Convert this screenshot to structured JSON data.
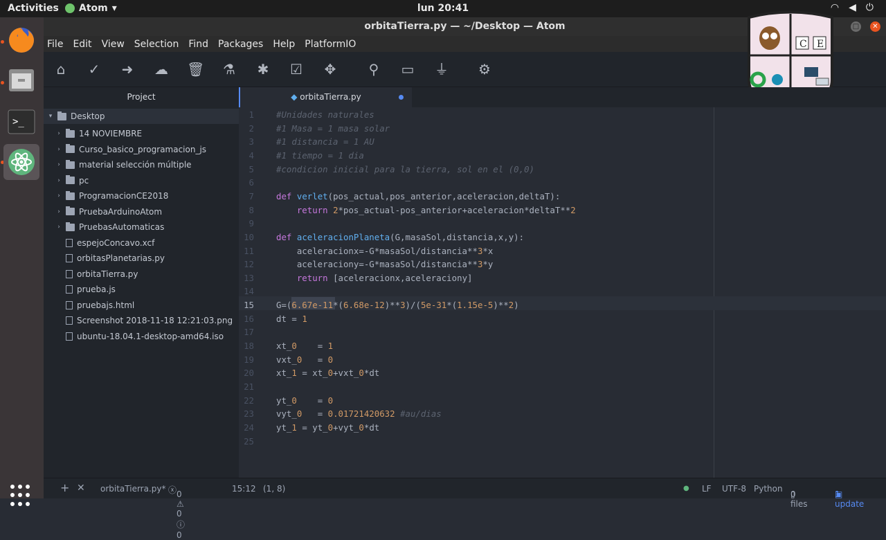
{
  "topbar": {
    "activities": "Activities",
    "app": "Atom",
    "clock": "lun 20:41"
  },
  "window": {
    "title": "orbitaTierra.py — ~/Desktop — Atom"
  },
  "menu": [
    "File",
    "Edit",
    "View",
    "Selection",
    "Find",
    "Packages",
    "Help",
    "PlatformIO"
  ],
  "toolbar": {
    "icons": [
      "home-icon",
      "check-icon",
      "arrow-right-icon",
      "cloud-upload-icon",
      "trash-icon",
      "flask-icon",
      "bug-icon",
      "checklist-icon",
      "plugin-icon",
      "search-icon",
      "terminal-icon",
      "plug-icon",
      "gear-icon"
    ]
  },
  "sidebar": {
    "header": "Project",
    "root": "Desktop",
    "items": [
      {
        "label": "14 NOVIEMBRE",
        "type": "folder"
      },
      {
        "label": "Curso_basico_programacion_js",
        "type": "folder"
      },
      {
        "label": "material selección múltiple",
        "type": "folder"
      },
      {
        "label": "pc",
        "type": "folder"
      },
      {
        "label": "ProgramacionCE2018",
        "type": "folder"
      },
      {
        "label": "PruebaArduinoAtom",
        "type": "folder"
      },
      {
        "label": "PruebasAutomaticas",
        "type": "folder"
      },
      {
        "label": "espejoConcavo.xcf",
        "type": "file"
      },
      {
        "label": "orbitasPlanetarias.py",
        "type": "file"
      },
      {
        "label": "orbitaTierra.py",
        "type": "file"
      },
      {
        "label": "prueba.js",
        "type": "file"
      },
      {
        "label": "pruebajs.html",
        "type": "file"
      },
      {
        "label": "Screenshot 2018-11-18 12:21:03.png",
        "type": "file"
      },
      {
        "label": "ubuntu-18.04.1-desktop-amd64.iso",
        "type": "file"
      }
    ]
  },
  "tab": {
    "label": "orbitaTierra.py"
  },
  "colors": {
    "accent": "#568af2",
    "background": "#282c34"
  },
  "editor": {
    "lines": [
      "#Unidades naturales",
      "#1 Masa = 1 masa solar",
      "#1 distancia = 1 AU",
      "#1 tiempo = 1 dia",
      "#condicion inicial para la tierra, sol en el (0,0)",
      "",
      "def verlet(pos_actual,pos_anterior,aceleracion,deltaT):",
      "    return 2*pos_actual-pos_anterior+aceleracion*deltaT**2",
      "",
      "def aceleracionPlaneta(G,masaSol,distancia,x,y):",
      "    aceleracionx=-G*masaSol/distancia**3*x",
      "    aceleraciony=-G*masaSol/distancia**3*y",
      "    return [aceleracionx,aceleraciony]",
      "",
      "G=(6.67e-11*(6.68e-12)**3)/(5e-31*(1.15e-5)**2)",
      "dt = 1",
      "",
      "xt_0    = 1",
      "vxt_0   = 0",
      "xt_1 = xt_0+vxt_0*dt",
      "",
      "yt_0    = 0",
      "vyt_0   = 0.01721420632 #au/dias",
      "yt_1 = yt_0+vyt_0*dt",
      ""
    ]
  },
  "status": {
    "file": "orbitaTierra.py*",
    "counts": "0 ⚠ 0 ⓘ 0",
    "position": "15:12",
    "selection": "(1, 8)",
    "eol": "LF",
    "encoding": "UTF-8",
    "grammar": "Python",
    "git": "0 files",
    "update": "1 update"
  },
  "logo": {
    "letters": [
      "C",
      "E"
    ]
  }
}
